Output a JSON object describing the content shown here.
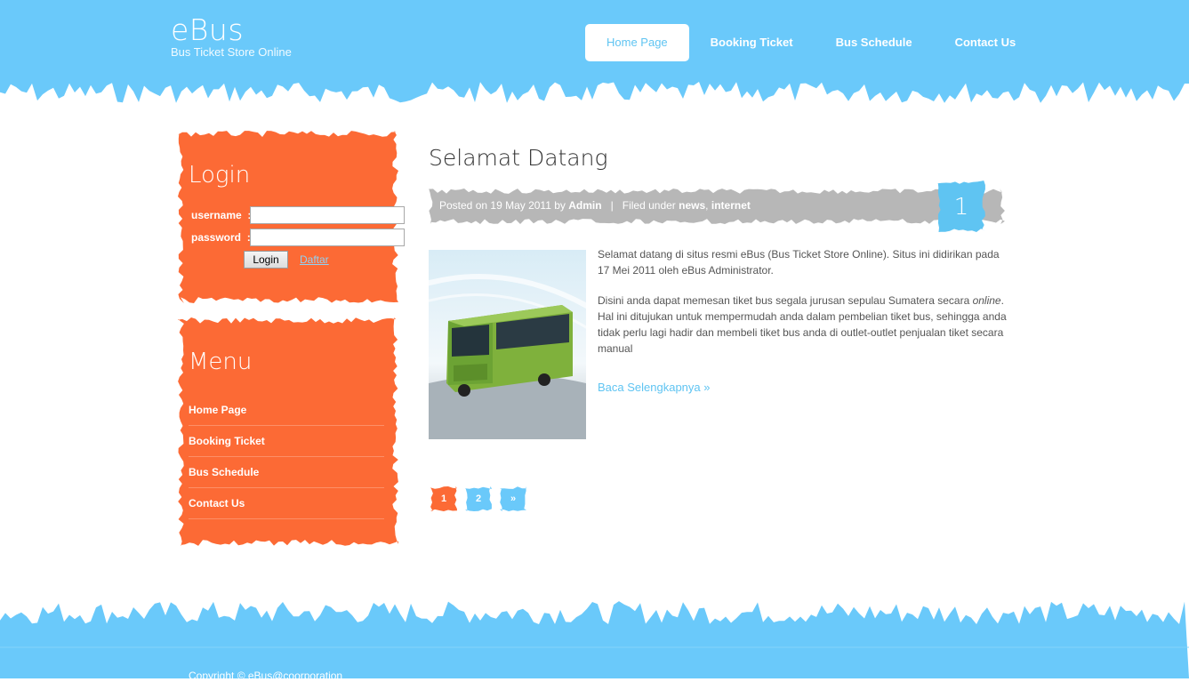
{
  "colors": {
    "sky": "#6ac9fa",
    "orange": "#fc6a35",
    "meta_gray": "#b7b7b7",
    "link_blue": "#5fc4f2"
  },
  "header": {
    "logo_title": "eBus",
    "logo_subtitle": "Bus Ticket Store Online",
    "nav": [
      "Home Page",
      "Booking Ticket",
      "Bus Schedule",
      "Contact Us"
    ],
    "active_nav": "Home Page"
  },
  "login": {
    "title": "Login",
    "username_label": "username",
    "password_label": "password",
    "separator": ":",
    "username_value": "",
    "password_value": "",
    "button_label": "Login",
    "register_link": "Daftar"
  },
  "menu": {
    "title": "Menu",
    "items": [
      "Home Page",
      "Booking Ticket",
      "Bus Schedule",
      "Contact Us"
    ]
  },
  "post": {
    "title": "Selamat Datang",
    "meta_posted_on": "Posted on",
    "date": "19 May 2011",
    "meta_by": "by",
    "author": "Admin",
    "meta_sep": "|",
    "meta_filed_under": "Filed under",
    "category_1": "news",
    "category_sep": ",",
    "category_2": "internet",
    "comment_count": "1",
    "paragraph_1": "Selamat datang di situs resmi eBus (Bus Ticket Store Online). Situs ini didirikan pada 17 Mei 2011 oleh eBus Administrator.",
    "paragraph_2_a": "Disini anda dapat memesan tiket bus segala jurusan sepulau Sumatera secara ",
    "paragraph_2_em": "online",
    "paragraph_2_b": ". Hal ini ditujukan untuk mempermudah anda dalam pembelian tiket bus, sehingga anda tidak perlu lagi hadir dan membeli tiket bus anda di outlet-outlet penjualan tiket secara manual",
    "read_more": "Baca Selengkapnya »"
  },
  "pagination": [
    "1",
    "2",
    "»"
  ],
  "pagination_current": "1",
  "footer": {
    "copyright": "Copyright © eBus@coorporation"
  }
}
